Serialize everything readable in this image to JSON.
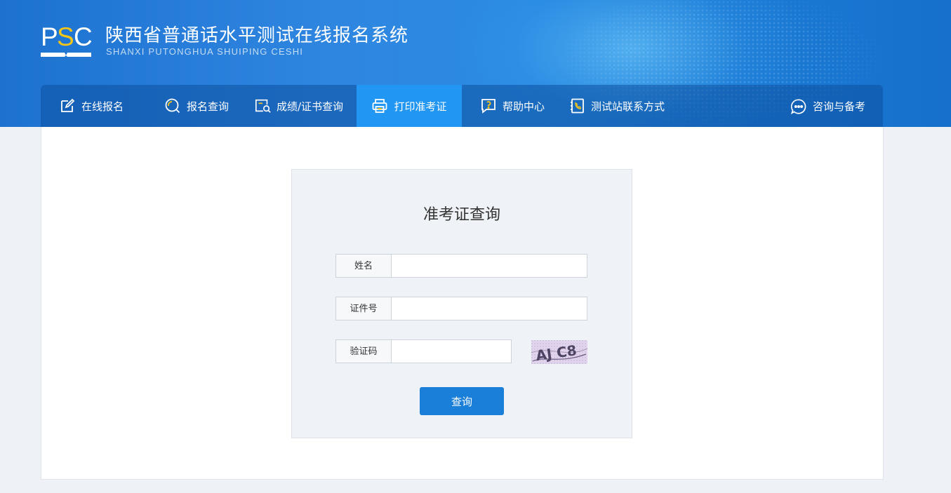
{
  "header": {
    "logo_text": "PSC",
    "title": "陕西省普通话水平测试在线报名系统",
    "subtitle": "SHANXI PUTONGHUA SHUIPING CESHI"
  },
  "nav": {
    "items": [
      {
        "label": "在线报名",
        "icon": "edit-icon"
      },
      {
        "label": "报名查询",
        "icon": "search-circle-icon"
      },
      {
        "label": "成绩/证书查询",
        "icon": "document-search-icon"
      },
      {
        "label": "打印准考证",
        "icon": "printer-icon",
        "active": true
      },
      {
        "label": "帮助中心",
        "icon": "help-icon"
      },
      {
        "label": "测试站联系方式",
        "icon": "phone-book-icon"
      },
      {
        "label": "咨询与备考",
        "icon": "chat-icon"
      }
    ]
  },
  "form": {
    "title": "准考证查询",
    "fields": [
      {
        "label": "姓名",
        "value": "",
        "placeholder": ""
      },
      {
        "label": "证件号",
        "value": "",
        "placeholder": ""
      },
      {
        "label": "验证码",
        "value": "",
        "placeholder": ""
      }
    ],
    "captcha_text": "AJ C8",
    "submit_label": "查询"
  },
  "colors": {
    "header_blue": "#2a86e0",
    "active_tab": "#2196f3",
    "button": "#1a7fd9",
    "logo_accent": "#f5c518"
  }
}
